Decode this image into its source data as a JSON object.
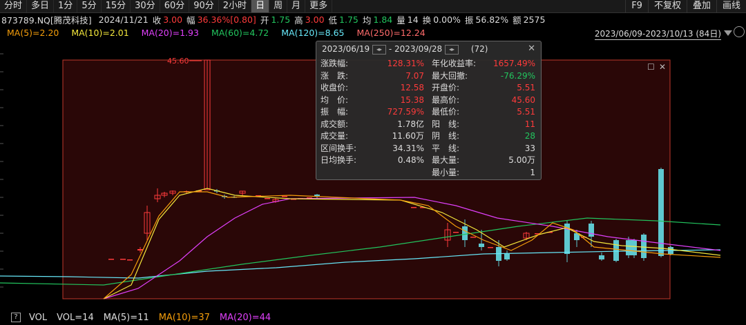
{
  "toolbar": {
    "periods": [
      "分时",
      "多日",
      "1分",
      "5分",
      "15分",
      "30分",
      "60分",
      "90分",
      "2小时",
      "日",
      "周",
      "月",
      "更多"
    ],
    "active": "日",
    "right": [
      "F9",
      "不复权",
      "叠加",
      "画线"
    ]
  },
  "quote": {
    "code": "873789.NQ[腾茂科技]",
    "date": "2024/11/21",
    "close_label": "收",
    "close": "3.00",
    "change_label": "幅",
    "change": "36.36%[0.80]",
    "open_label": "开",
    "open": "1.75",
    "high_label": "高",
    "high": "3.00",
    "low_label": "低",
    "low": "1.75",
    "avg_label": "均",
    "avg": "1.84",
    "vol_label": "量",
    "vol": "14",
    "turnover_label": "换",
    "turnover": "0.00%",
    "amp_label": "振",
    "amp": "56.82%",
    "amount_label": "额",
    "amount": "2575"
  },
  "ma": {
    "ma5": "MA(5)=2.20",
    "ma10": "MA(10)=2.01",
    "ma20": "MA(20)=1.93",
    "ma60": "MA(60)=4.72",
    "ma120": "MA(120)=8.65",
    "ma250": "MA(250)=12.24"
  },
  "colors": {
    "ma5": "#f59e0b",
    "ma10": "#f5e83c",
    "ma20": "#e040fb",
    "ma60": "#22c55e",
    "ma120": "#67e8f9",
    "ma250": "#ff6b6b",
    "up": "#ff3b3b",
    "down": "#5ec8d0"
  },
  "range": "2023/06/09-2023/10/13 (84日)",
  "high_marker": "45.60",
  "popup": {
    "start": "2023/06/19",
    "sep": "-",
    "end": "2023/09/28",
    "count": "(72)",
    "left": [
      {
        "label": "涨跌幅:",
        "value": "128.31%",
        "color": "red"
      },
      {
        "label": "涨　跌:",
        "value": "7.07",
        "color": "red"
      },
      {
        "label": "收盘价:",
        "value": "12.58",
        "color": "red"
      },
      {
        "label": "均　价:",
        "value": "15.38",
        "color": "red"
      },
      {
        "label": "振　幅:",
        "value": "727.59%",
        "color": "red"
      },
      {
        "label": "成交额:",
        "value": "1.78亿",
        "color": "white"
      },
      {
        "label": "成交量:",
        "value": "11.60万",
        "color": "white"
      },
      {
        "label": "区间换手:",
        "value": "34.31%",
        "color": "white"
      },
      {
        "label": "日均换手:",
        "value": "0.48%",
        "color": "white"
      }
    ],
    "right": [
      {
        "label": "年化收益率:",
        "value": "1657.49%",
        "color": "red"
      },
      {
        "label": "最大回撤:",
        "value": "-76.29%",
        "color": "green"
      },
      {
        "label": "开盘价:",
        "value": "5.51",
        "color": "red"
      },
      {
        "label": "最高价:",
        "value": "45.60",
        "color": "red"
      },
      {
        "label": "最低价:",
        "value": "5.51",
        "color": "red"
      },
      {
        "label": "阳　线:",
        "value": "11",
        "color": "red"
      },
      {
        "label": "阴　线:",
        "value": "28",
        "color": "green"
      },
      {
        "label": "平　线:",
        "value": "33",
        "color": "white"
      },
      {
        "label": "最大量:",
        "value": "5.00万",
        "color": "white"
      },
      {
        "label": "最小量:",
        "value": "1",
        "color": "white"
      }
    ]
  },
  "volume": {
    "q": "?",
    "name": "VOL",
    "vol": "VOL=14",
    "ma5": "MA(5)=11",
    "ma10": "MA(10)=37",
    "ma20": "MA(20)=44"
  }
}
